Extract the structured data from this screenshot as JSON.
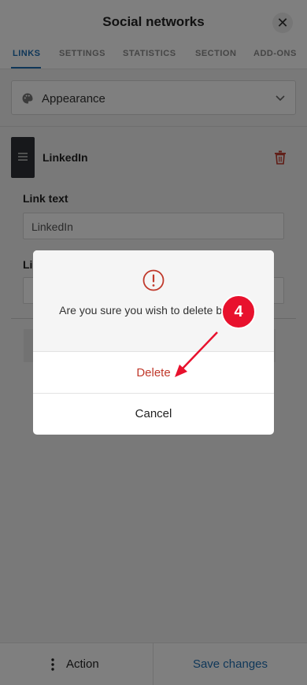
{
  "header": {
    "title": "Social networks",
    "close_icon": "close-icon"
  },
  "tabs": [
    {
      "label": "LINKS",
      "active": true
    },
    {
      "label": "SETTINGS",
      "active": false
    },
    {
      "label": "STATISTICS",
      "active": false
    },
    {
      "label": "SECTION",
      "active": false
    },
    {
      "label": "ADD-ONS",
      "active": false
    }
  ],
  "appearance": {
    "label": "Appearance",
    "icon": "palette-icon"
  },
  "block": {
    "title": "LinkedIn",
    "link_text_label": "Link text",
    "link_text_value": "LinkedIn",
    "link_label_partial": "Li"
  },
  "footer": {
    "action_label": "Action",
    "save_label": "Save changes"
  },
  "modal": {
    "message": "Are you sure you wish to delete block?",
    "delete_label": "Delete",
    "cancel_label": "Cancel"
  },
  "annotation": {
    "step": "4"
  },
  "colors": {
    "accent": "#1f6fb3",
    "danger": "#c0392b",
    "badge": "#e8112d"
  }
}
